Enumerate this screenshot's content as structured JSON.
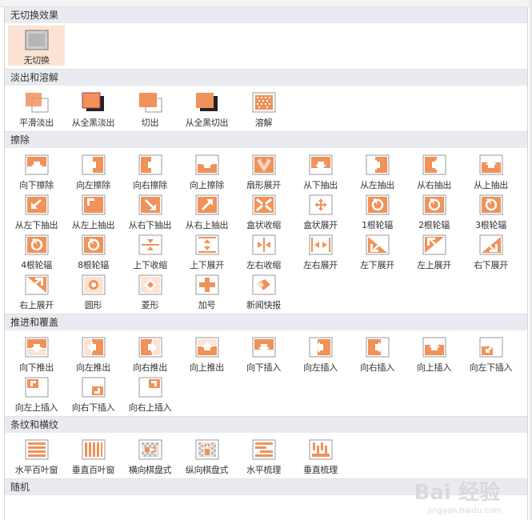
{
  "sections": [
    {
      "title": "无切换效果",
      "items": [
        {
          "label": "无切换",
          "icon": "none",
          "selected": true
        }
      ]
    },
    {
      "title": "淡出和溶解",
      "items": [
        {
          "label": "平滑淡出",
          "icon": "fade"
        },
        {
          "label": "从全黑淡出",
          "icon": "fade-black"
        },
        {
          "label": "切出",
          "icon": "cut"
        },
        {
          "label": "从全黑切出",
          "icon": "cut-black"
        },
        {
          "label": "溶解",
          "icon": "dissolve"
        }
      ]
    },
    {
      "title": "擦除",
      "items": [
        {
          "label": "向下擦除",
          "icon": "wipe-down"
        },
        {
          "label": "向左擦除",
          "icon": "wipe-left"
        },
        {
          "label": "向右擦除",
          "icon": "wipe-right"
        },
        {
          "label": "向上擦除",
          "icon": "wipe-up"
        },
        {
          "label": "扇形展开",
          "icon": "fan"
        },
        {
          "label": "从下抽出",
          "icon": "pull-down"
        },
        {
          "label": "从左抽出",
          "icon": "pull-left"
        },
        {
          "label": "从右抽出",
          "icon": "pull-right"
        },
        {
          "label": "从上抽出",
          "icon": "pull-up"
        },
        {
          "label": "从左下抽出",
          "icon": "pull-bl"
        },
        {
          "label": "从左上抽出",
          "icon": "pull-tl"
        },
        {
          "label": "从右下抽出",
          "icon": "pull-br"
        },
        {
          "label": "从右上抽出",
          "icon": "pull-tr"
        },
        {
          "label": "盒状收缩",
          "icon": "box-in"
        },
        {
          "label": "盒状展开",
          "icon": "box-out"
        },
        {
          "label": "1根轮辐",
          "icon": "wheel"
        },
        {
          "label": "2根轮辐",
          "icon": "wheel"
        },
        {
          "label": "3根轮辐",
          "icon": "wheel"
        },
        {
          "label": "4根轮辐",
          "icon": "wheel"
        },
        {
          "label": "8根轮辐",
          "icon": "wheel"
        },
        {
          "label": "上下收缩",
          "icon": "split-v-in"
        },
        {
          "label": "上下展开",
          "icon": "split-v-out"
        },
        {
          "label": "左右收缩",
          "icon": "split-h-in"
        },
        {
          "label": "左右展开",
          "icon": "split-h-out"
        },
        {
          "label": "左下展开",
          "icon": "diag-bl"
        },
        {
          "label": "左上展开",
          "icon": "diag-tl"
        },
        {
          "label": "右下展开",
          "icon": "diag-br"
        },
        {
          "label": "右上展开",
          "icon": "diag-tr"
        },
        {
          "label": "圆形",
          "icon": "circle"
        },
        {
          "label": "菱形",
          "icon": "diamond"
        },
        {
          "label": "加号",
          "icon": "plus"
        },
        {
          "label": "新闻快报",
          "icon": "newsflash"
        }
      ]
    },
    {
      "title": "推进和覆盖",
      "items": [
        {
          "label": "向下推出",
          "icon": "push-down"
        },
        {
          "label": "向左推出",
          "icon": "push-left"
        },
        {
          "label": "向右推出",
          "icon": "push-right"
        },
        {
          "label": "向上推出",
          "icon": "push-up"
        },
        {
          "label": "向下插入",
          "icon": "cover-down"
        },
        {
          "label": "向左插入",
          "icon": "cover-left"
        },
        {
          "label": "向右插入",
          "icon": "cover-right"
        },
        {
          "label": "向上插入",
          "icon": "cover-up"
        },
        {
          "label": "向左下插入",
          "icon": "cover-bl"
        },
        {
          "label": "向左上插入",
          "icon": "cover-tl"
        },
        {
          "label": "向右下插入",
          "icon": "cover-br"
        },
        {
          "label": "向右上插入",
          "icon": "cover-tr"
        }
      ]
    },
    {
      "title": "条纹和横纹",
      "items": [
        {
          "label": "水平百叶窗",
          "icon": "blinds-h"
        },
        {
          "label": "垂直百叶窗",
          "icon": "blinds-v"
        },
        {
          "label": "横向棋盘式",
          "icon": "checker-h"
        },
        {
          "label": "纵向棋盘式",
          "icon": "checker-v"
        },
        {
          "label": "水平梳理",
          "icon": "comb-h"
        },
        {
          "label": "垂直梳理",
          "icon": "comb-v"
        }
      ]
    },
    {
      "title": "随机",
      "items": []
    }
  ],
  "watermark": {
    "text": "Bai 经验",
    "url": "jingyan.baidu.com"
  },
  "colors": {
    "accent": "#f0925a",
    "selected_bg": "#fde3d3",
    "header_bg": "#e9ebf0"
  }
}
